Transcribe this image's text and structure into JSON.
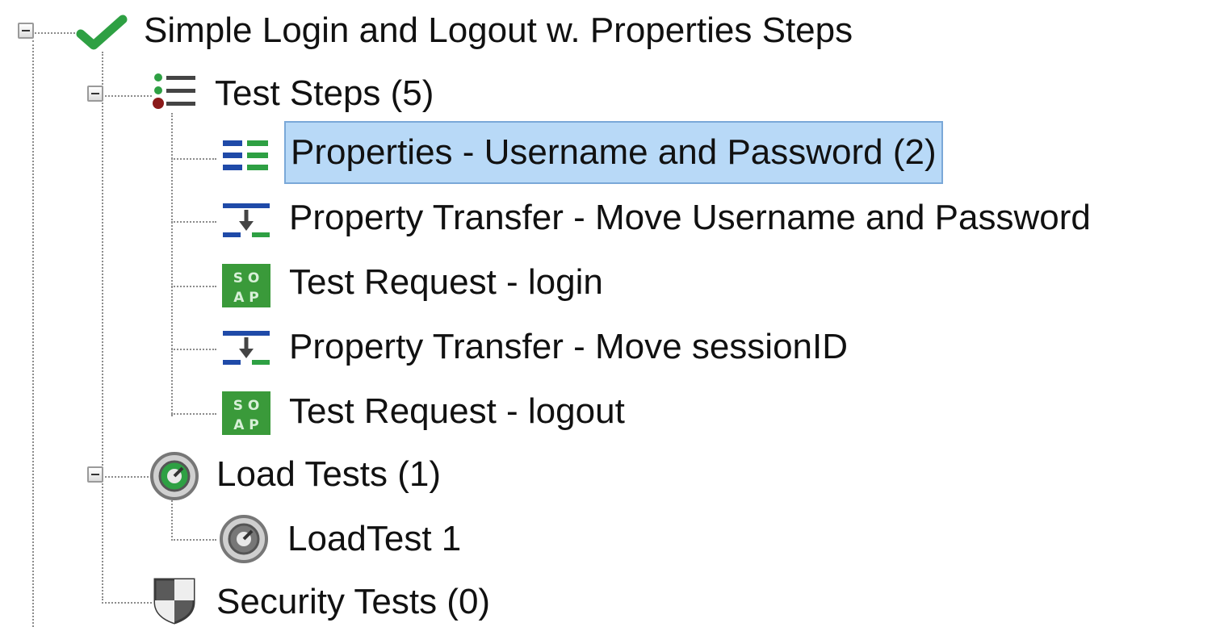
{
  "tree": {
    "root": {
      "label": "Simple Login and Logout w. Properties Steps",
      "icon": "green-checkmark-icon",
      "status": "passed"
    },
    "test_steps": {
      "label": "Test Steps (5)",
      "icon": "test-steps-list-icon",
      "items": [
        {
          "label": "Properties - Username and Password (2)",
          "icon": "properties-icon",
          "selected": true
        },
        {
          "label": "Property Transfer - Move Username and Password",
          "icon": "property-transfer-icon"
        },
        {
          "label": "Test Request - login",
          "icon": "soap-request-icon",
          "icon_text": "SOAP"
        },
        {
          "label": "Property Transfer - Move sessionID",
          "icon": "property-transfer-icon"
        },
        {
          "label": "Test Request - logout",
          "icon": "soap-request-icon",
          "icon_text": "SOAP"
        }
      ]
    },
    "load_tests": {
      "label": "Load Tests (1)",
      "icon": "load-tests-icon",
      "items": [
        {
          "label": "LoadTest 1",
          "icon": "load-test-gauge-icon"
        }
      ]
    },
    "security_tests": {
      "label": "Security Tests (0)",
      "icon": "security-shield-icon"
    }
  },
  "colors": {
    "selection_bg": "#b8d9f7",
    "selection_border": "#7aa8d8",
    "check_green": "#2ea043",
    "soap_green": "#3a9a3a",
    "step_blue": "#1f4aa8"
  }
}
